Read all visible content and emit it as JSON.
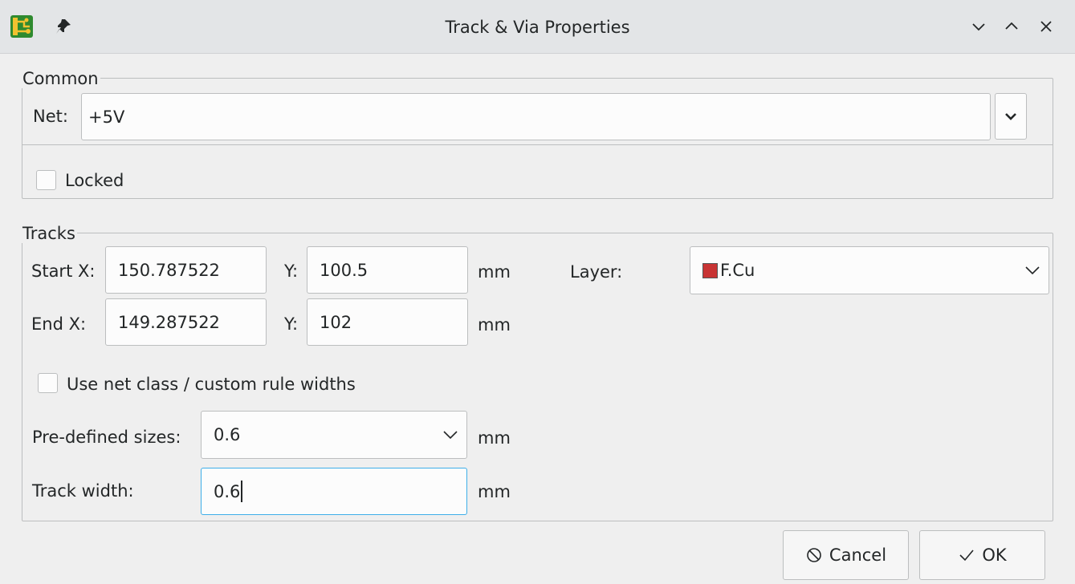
{
  "window": {
    "title": "Track & Via Properties"
  },
  "common": {
    "group_title": "Common",
    "net_label": "Net:",
    "net_value": "+5V",
    "locked_label": "Locked",
    "locked_checked": false
  },
  "tracks": {
    "group_title": "Tracks",
    "start_x_label": "Start X:",
    "start_x_value": "150.787522",
    "start_y_label": "Y:",
    "start_y_value": "100.5",
    "end_x_label": "End X:",
    "end_x_value": "149.287522",
    "end_y_label": "Y:",
    "end_y_value": "102",
    "unit_start": "mm",
    "unit_end": "mm",
    "layer_label": "Layer:",
    "layer_value": "F.Cu",
    "layer_color": "#c83434",
    "netclass_label": "Use net class / custom rule widths",
    "netclass_checked": false,
    "predefined_label": "Pre-defined sizes:",
    "predefined_value": "0.6",
    "unit_predefined": "mm",
    "width_label": "Track width:",
    "width_value": "0.6",
    "unit_width": "mm"
  },
  "buttons": {
    "cancel_label": "Cancel",
    "ok_label": "OK"
  }
}
